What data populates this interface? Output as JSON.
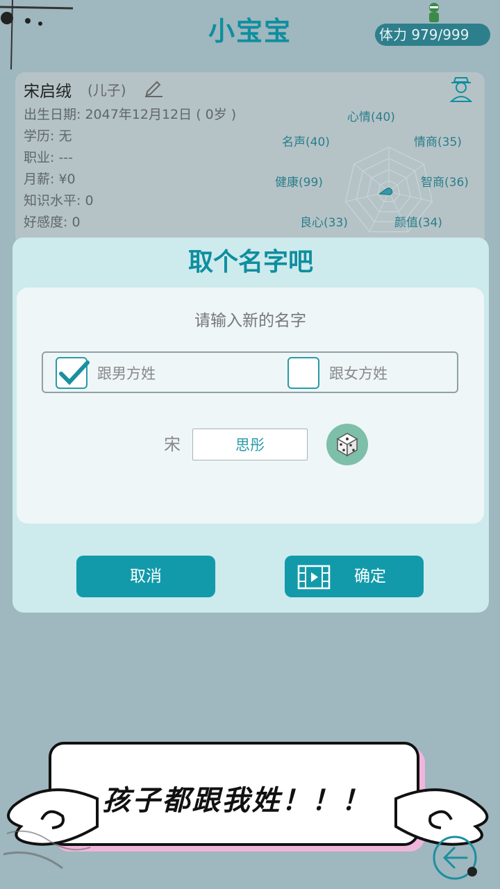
{
  "header": {
    "title": "小宝宝",
    "stamina_label": "体力",
    "stamina_value": "979/999"
  },
  "profile": {
    "name": "宋启绒",
    "relation": "(儿子)",
    "birth": "出生日期: 2047年12月12日 ( 0岁 )",
    "education": "学历: 无",
    "job": "职业: ---",
    "salary": "月薪: ¥0",
    "knowledge": "知识水平: 0",
    "affection": "好感度: 0",
    "stats": [
      {
        "label": "心情(40)",
        "value": 40
      },
      {
        "label": "情商(35)",
        "value": 35
      },
      {
        "label": "智商(36)",
        "value": 36
      },
      {
        "label": "颜值(34)",
        "value": 34
      },
      {
        "label": "良心(33)",
        "value": 33
      },
      {
        "label": "健康(99)",
        "value": 99
      },
      {
        "label": "名声(40)",
        "value": 40
      }
    ]
  },
  "dialog": {
    "title": "取个名字吧",
    "prompt": "请输入新的名字",
    "option_father": "跟男方姓",
    "option_mother": "跟女方姓",
    "father_checked": true,
    "mother_checked": false,
    "surname": "宋",
    "given_name": "思彤",
    "cancel_label": "取消",
    "confirm_label": "确定"
  },
  "bubble": {
    "text": "孩子都跟我姓！！！"
  },
  "colors": {
    "accent": "#0f8e9e",
    "button": "#139aaa",
    "background": "#9fb7be"
  },
  "icons": [
    "edit-icon",
    "person-icon",
    "check-icon",
    "dice-icon",
    "film-icon",
    "back-arrow-icon"
  ]
}
